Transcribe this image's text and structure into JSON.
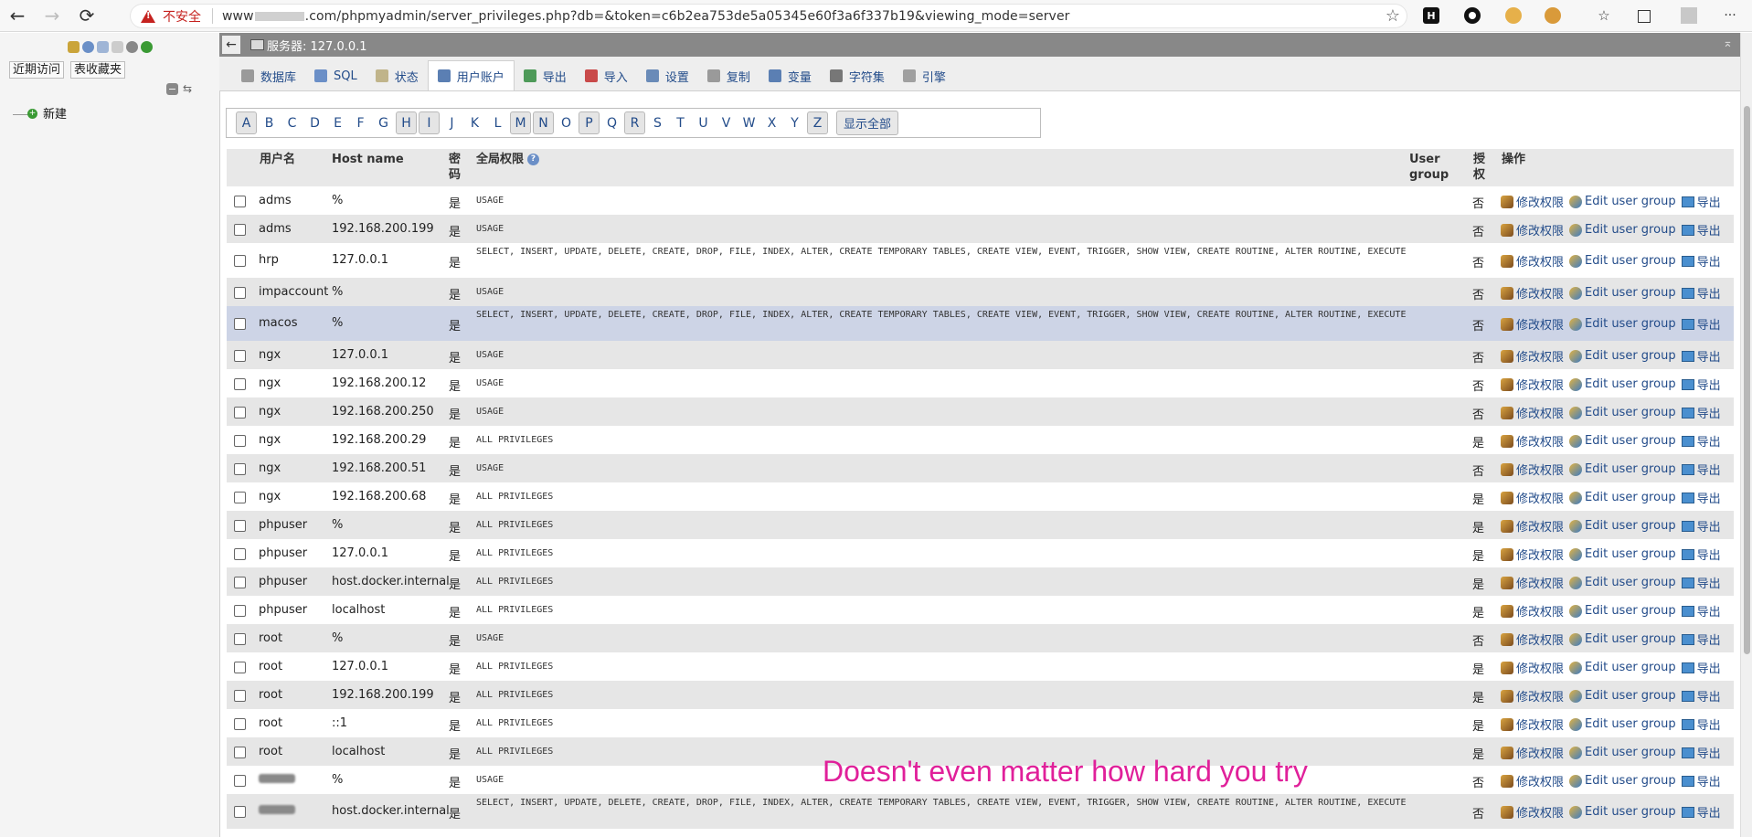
{
  "browser": {
    "back_icon": "←",
    "forward_icon": "→",
    "reload_icon": "⟳",
    "insecure_label": "不安全",
    "url_prefix": "www",
    "url_rest": ".com/phpmyadmin/server_privileges.php?db=&token=c6b2ea753de5a05345e60f3a6f337b19&viewing_mode=server",
    "star_icon": "☆",
    "more_icon": "···"
  },
  "left_panel": {
    "recent_label": "近期访问",
    "favorites_label": "表收藏夹",
    "new_label": "新建"
  },
  "server_bar": {
    "toggle_icon": "←",
    "title": "服务器: 127.0.0.1",
    "pin_icon": "⌅"
  },
  "tabs": [
    {
      "label": "数据库",
      "icon_color": "#9a9a9a"
    },
    {
      "label": "SQL",
      "icon_color": "#6b8fc7"
    },
    {
      "label": "状态",
      "icon_color": "#c0b48a"
    },
    {
      "label": "用户账户",
      "icon_color": "#5b7fb3"
    },
    {
      "label": "导出",
      "icon_color": "#4e9a59"
    },
    {
      "label": "导入",
      "icon_color": "#c94a4a"
    },
    {
      "label": "设置",
      "icon_color": "#6a8bb8"
    },
    {
      "label": "复制",
      "icon_color": "#9a9a9a"
    },
    {
      "label": "变量",
      "icon_color": "#5b7fb3"
    },
    {
      "label": "字符集",
      "icon_color": "#777777"
    },
    {
      "label": "引擎",
      "icon_color": "#a0a0a0"
    }
  ],
  "active_tab_index": 3,
  "alphabet": [
    "A",
    "B",
    "C",
    "D",
    "E",
    "F",
    "G",
    "H",
    "I",
    "J",
    "K",
    "L",
    "M",
    "N",
    "O",
    "P",
    "Q",
    "R",
    "S",
    "T",
    "U",
    "V",
    "W",
    "X",
    "Y",
    "Z"
  ],
  "alphabet_highlighted": [
    "A",
    "H",
    "I",
    "M",
    "N",
    "P",
    "R",
    "Z"
  ],
  "show_all_label": "显示全部",
  "table": {
    "headers": {
      "user": "用户名",
      "host": "Host name",
      "password": "密码",
      "global": "全局权限",
      "user_group_1": "User",
      "user_group_2": "group",
      "grant_1": "授",
      "grant_2": "权",
      "actions": "操作"
    },
    "action_labels": {
      "edit": "修改权限",
      "group": "Edit user group",
      "export": "导出"
    },
    "rows": [
      {
        "user": "adms",
        "host": "%",
        "pw": "是",
        "priv": "USAGE",
        "grant": "否",
        "tall": false
      },
      {
        "user": "adms",
        "host": "192.168.200.199",
        "pw": "是",
        "priv": "USAGE",
        "grant": "否",
        "tall": false
      },
      {
        "user": "hrp",
        "host": "127.0.0.1",
        "pw": "是",
        "priv": "SELECT, INSERT, UPDATE, DELETE, CREATE, DROP, FILE, INDEX, ALTER, CREATE TEMPORARY TABLES, CREATE VIEW, EVENT, TRIGGER, SHOW VIEW, CREATE ROUTINE, ALTER ROUTINE, EXECUTE",
        "grant": "否",
        "tall": true
      },
      {
        "user": "impaccount",
        "host": "%",
        "pw": "是",
        "priv": "USAGE",
        "grant": "否",
        "tall": false
      },
      {
        "user": "macos",
        "host": "%",
        "pw": "是",
        "priv": "SELECT, INSERT, UPDATE, DELETE, CREATE, DROP, FILE, INDEX, ALTER, CREATE TEMPORARY TABLES, CREATE VIEW, EVENT, TRIGGER, SHOW VIEW, CREATE ROUTINE, ALTER ROUTINE, EXECUTE",
        "grant": "否",
        "tall": true,
        "hl": true
      },
      {
        "user": "ngx",
        "host": "127.0.0.1",
        "pw": "是",
        "priv": "USAGE",
        "grant": "否",
        "tall": false
      },
      {
        "user": "ngx",
        "host": "192.168.200.12",
        "pw": "是",
        "priv": "USAGE",
        "grant": "否",
        "tall": false
      },
      {
        "user": "ngx",
        "host": "192.168.200.250",
        "pw": "是",
        "priv": "USAGE",
        "grant": "否",
        "tall": false
      },
      {
        "user": "ngx",
        "host": "192.168.200.29",
        "pw": "是",
        "priv": "ALL PRIVILEGES",
        "grant": "是",
        "tall": false
      },
      {
        "user": "ngx",
        "host": "192.168.200.51",
        "pw": "是",
        "priv": "USAGE",
        "grant": "否",
        "tall": false
      },
      {
        "user": "ngx",
        "host": "192.168.200.68",
        "pw": "是",
        "priv": "ALL PRIVILEGES",
        "grant": "是",
        "tall": false
      },
      {
        "user": "phpuser",
        "host": "%",
        "pw": "是",
        "priv": "ALL PRIVILEGES",
        "grant": "是",
        "tall": false
      },
      {
        "user": "phpuser",
        "host": "127.0.0.1",
        "pw": "是",
        "priv": "ALL PRIVILEGES",
        "grant": "是",
        "tall": false
      },
      {
        "user": "phpuser",
        "host": "host.docker.internal",
        "pw": "是",
        "priv": "ALL PRIVILEGES",
        "grant": "是",
        "tall": false
      },
      {
        "user": "phpuser",
        "host": "localhost",
        "pw": "是",
        "priv": "ALL PRIVILEGES",
        "grant": "是",
        "tall": false
      },
      {
        "user": "root",
        "host": "%",
        "pw": "是",
        "priv": "USAGE",
        "grant": "否",
        "tall": false
      },
      {
        "user": "root",
        "host": "127.0.0.1",
        "pw": "是",
        "priv": "ALL PRIVILEGES",
        "grant": "是",
        "tall": false
      },
      {
        "user": "root",
        "host": "192.168.200.199",
        "pw": "是",
        "priv": "ALL PRIVILEGES",
        "grant": "是",
        "tall": false
      },
      {
        "user": "root",
        "host": "::1",
        "pw": "是",
        "priv": "ALL PRIVILEGES",
        "grant": "是",
        "tall": false
      },
      {
        "user": "root",
        "host": "localhost",
        "pw": "是",
        "priv": "ALL PRIVILEGES",
        "grant": "是",
        "tall": false
      },
      {
        "user": "",
        "redacted": true,
        "host": "%",
        "pw": "是",
        "priv": "USAGE",
        "grant": "否",
        "tall": false
      },
      {
        "user": "",
        "redacted": true,
        "host": "host.docker.internal",
        "pw": "是",
        "priv": "SELECT, INSERT, UPDATE, DELETE, CREATE, DROP, FILE, INDEX, ALTER, CREATE TEMPORARY TABLES, CREATE VIEW, EVENT, TRIGGER, SHOW VIEW, CREATE ROUTINE, ALTER ROUTINE, EXECUTE",
        "grant": "否",
        "tall": true
      }
    ]
  },
  "overlay_text": "Doesn't even matter how hard you try"
}
